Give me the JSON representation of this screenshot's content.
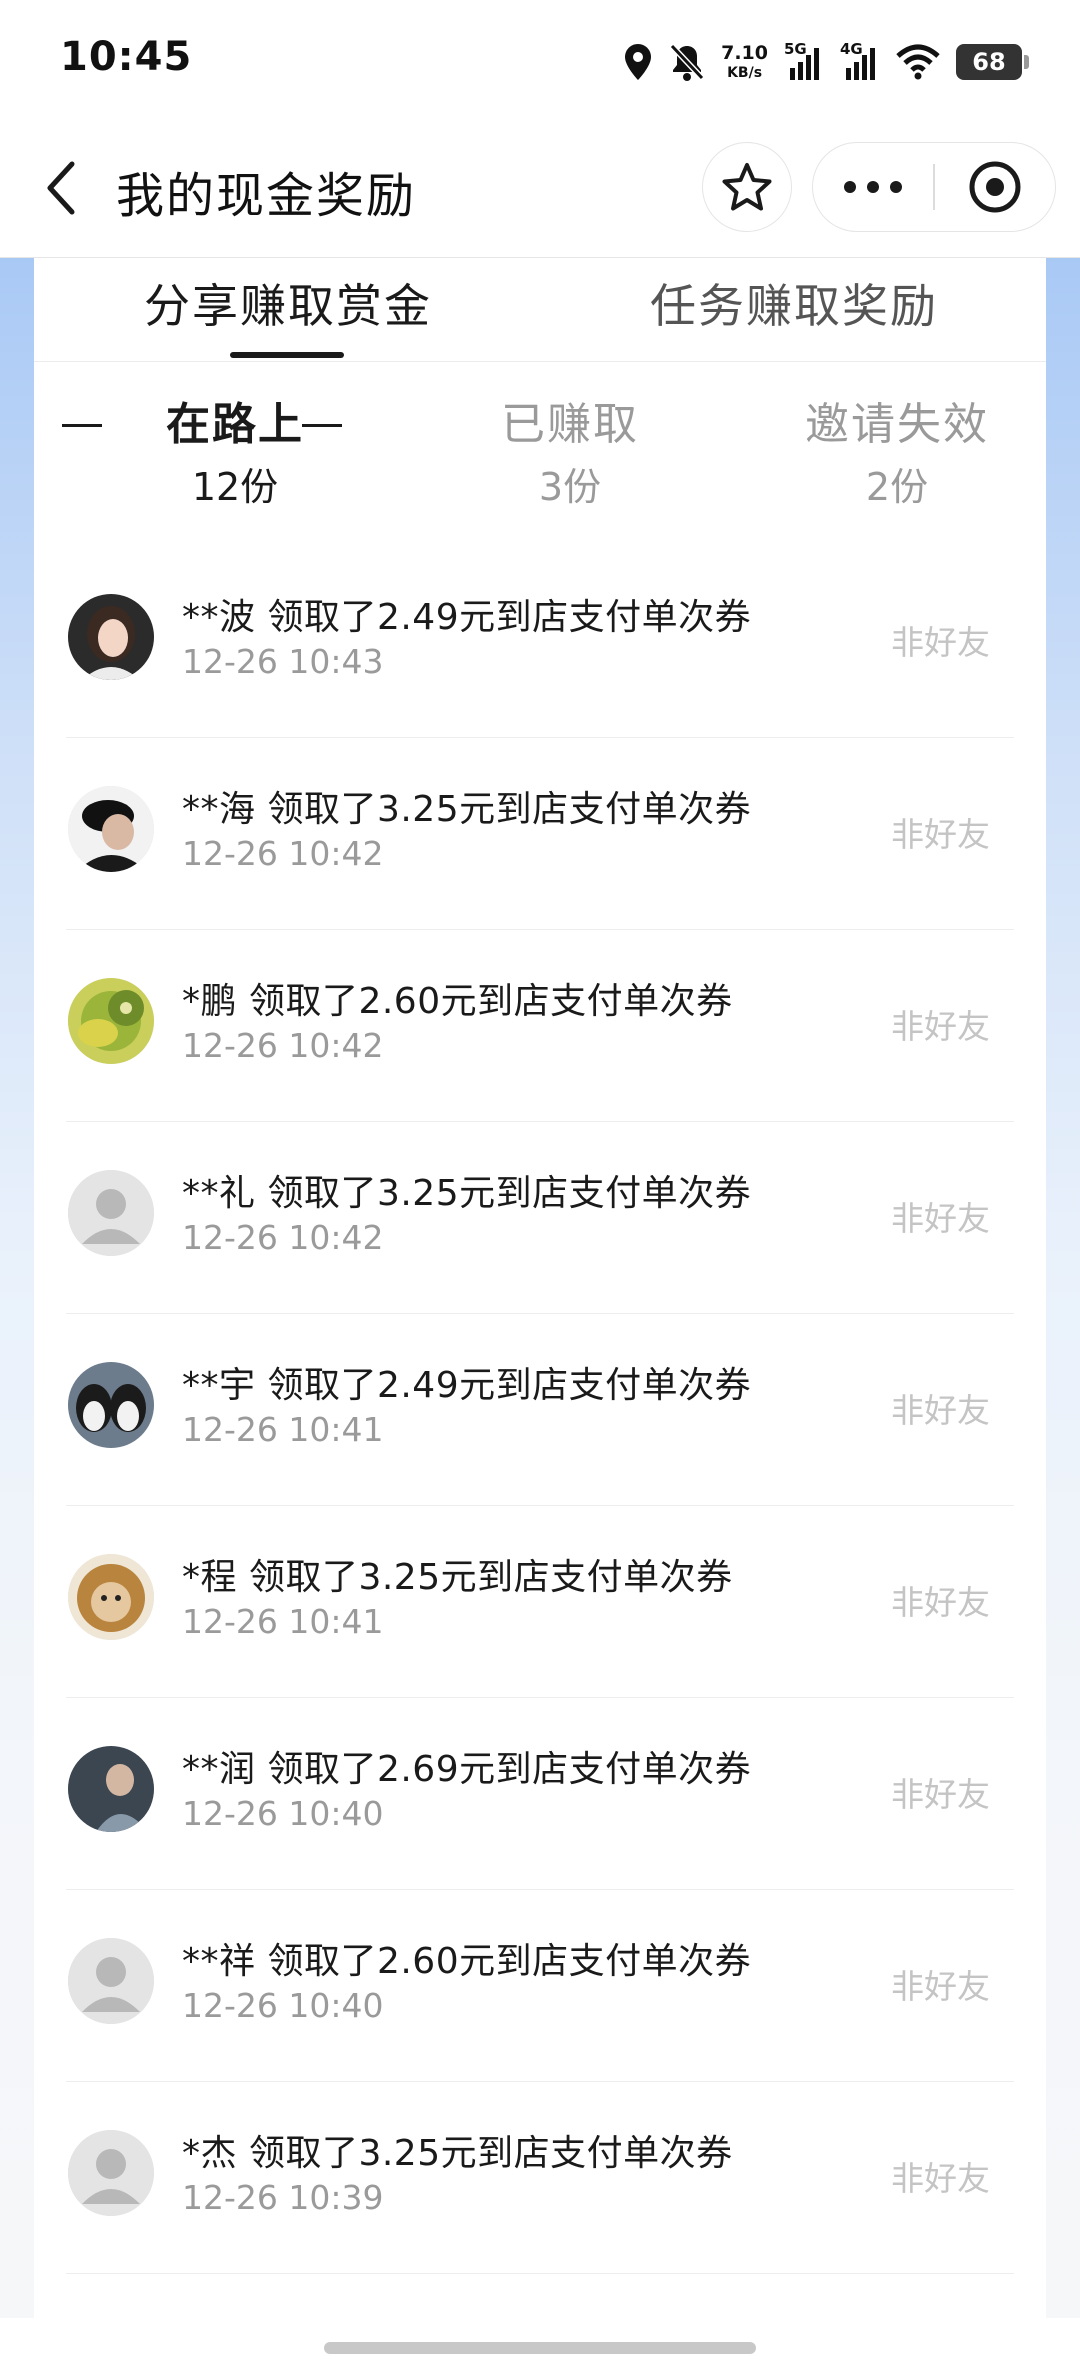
{
  "status_bar": {
    "time": "10:45",
    "net_speed_value": "7.10",
    "net_speed_unit": "KB/s",
    "sim1_label": "5G",
    "sim2_label": "4G",
    "battery": "68",
    "icons": [
      "location-icon",
      "bell-muted-icon",
      "signal-icon",
      "signal-icon",
      "wifi-icon",
      "battery-icon"
    ]
  },
  "nav": {
    "title": "我的现金奖励",
    "icons": [
      "back-chevron-icon",
      "star-icon",
      "more-dots-icon",
      "close-target-icon"
    ]
  },
  "tabs": [
    {
      "label": "分享赚取赏金",
      "active": true
    },
    {
      "label": "任务赚取奖励",
      "active": false
    }
  ],
  "subtabs": [
    {
      "label": "在路上",
      "count": "12份",
      "selected": true
    },
    {
      "label": "已赚取",
      "count": "3份",
      "selected": false
    },
    {
      "label": "邀请失效",
      "count": "2份",
      "selected": false
    }
  ],
  "records": [
    {
      "title": "**波 领取了2.49元到店支付单次券",
      "time": "12-26 10:43",
      "tag": "非好友",
      "avatar": "girl-photo"
    },
    {
      "title": "**海 领取了3.25元到店支付单次券",
      "time": "12-26 10:42",
      "tag": "非好友",
      "avatar": "man-cap-photo"
    },
    {
      "title": "*鹏 领取了2.60元到店支付单次券",
      "time": "12-26 10:42",
      "tag": "非好友",
      "avatar": "kiwi-photo"
    },
    {
      "title": "**礼 领取了3.25元到店支付单次券",
      "time": "12-26 10:42",
      "tag": "非好友",
      "avatar": "default-person"
    },
    {
      "title": "**宇 领取了2.49元到店支付单次券",
      "time": "12-26 10:41",
      "tag": "非好友",
      "avatar": "penguins-photo"
    },
    {
      "title": "*程 领取了3.25元到店支付单次券",
      "time": "12-26 10:41",
      "tag": "非好友",
      "avatar": "lion-cat-photo"
    },
    {
      "title": "**润 领取了2.69元到店支付单次券",
      "time": "12-26 10:40",
      "tag": "非好友",
      "avatar": "man-photo"
    },
    {
      "title": "**祥 领取了2.60元到店支付单次券",
      "time": "12-26 10:40",
      "tag": "非好友",
      "avatar": "default-person"
    },
    {
      "title": "*杰 领取了3.25元到店支付单次券",
      "time": "12-26 10:39",
      "tag": "非好友",
      "avatar": "default-person"
    }
  ],
  "colors": {
    "text_primary": "#1a1a1a",
    "text_secondary": "#9a9a9a",
    "tag_text": "#c4c4c4",
    "backdrop_top": "#a9c9f5"
  }
}
